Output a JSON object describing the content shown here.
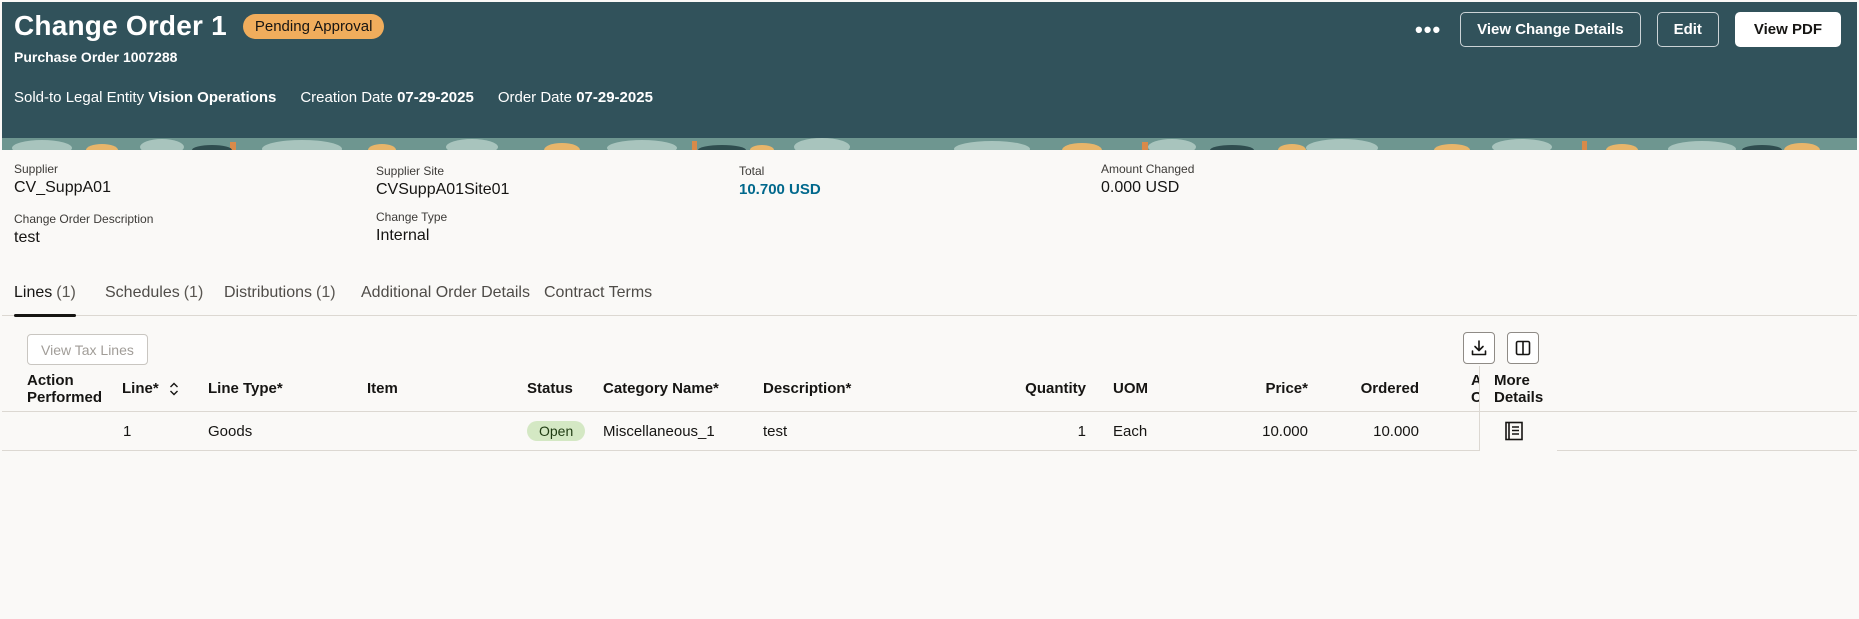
{
  "header": {
    "title": "Change Order 1",
    "status_badge": "Pending Approval",
    "subtitle": "Purchase Order 1007288",
    "meta": [
      {
        "label": "Sold-to Legal Entity",
        "value": "Vision Operations"
      },
      {
        "label": "Creation Date",
        "value": "07-29-2025"
      },
      {
        "label": "Order Date",
        "value": "07-29-2025"
      }
    ],
    "actions": {
      "more_label": "•••",
      "view_change_details": "View Change Details",
      "edit": "Edit",
      "view_pdf": "View PDF"
    }
  },
  "summary": {
    "supplier": {
      "label": "Supplier",
      "value": "CV_SuppA01"
    },
    "supplier_site": {
      "label": "Supplier Site",
      "value": "CVSuppA01Site01"
    },
    "total": {
      "label": "Total",
      "value": "10.700 USD"
    },
    "amount_changed": {
      "label": "Amount Changed",
      "value": "0.000 USD"
    },
    "description": {
      "label": "Change Order Description",
      "value": "test"
    },
    "change_type": {
      "label": "Change Type",
      "value": "Internal"
    }
  },
  "tabs": [
    {
      "label": "Lines",
      "count": "(1)",
      "active": true
    },
    {
      "label": "Schedules",
      "count": "(1)"
    },
    {
      "label": "Distributions",
      "count": "(1)"
    },
    {
      "label": "Additional Order Details",
      "count": ""
    },
    {
      "label": "Contract Terms",
      "count": ""
    }
  ],
  "toolbar": {
    "view_tax_lines": "View Tax Lines",
    "download_icon": "download-icon",
    "columns_icon": "columns-icon"
  },
  "table": {
    "headers": {
      "action_performed_1": "Action",
      "action_performed_2": "Performed",
      "line": "Line*",
      "line_type": "Line Type*",
      "item": "Item",
      "status": "Status",
      "category_name": "Category Name*",
      "description": "Description*",
      "quantity": "Quantity",
      "uom": "UOM",
      "price": "Price*",
      "ordered": "Ordered",
      "clipped": "A\nC",
      "more_details_1": "More",
      "more_details_2": "Details"
    },
    "rows": [
      {
        "action_performed": "",
        "line": "1",
        "line_type": "Goods",
        "item": "",
        "status": "Open",
        "category_name": "Miscellaneous_1",
        "description": "test",
        "quantity": "1",
        "uom": "Each",
        "price": "10.000",
        "ordered": "10.000"
      }
    ]
  }
}
